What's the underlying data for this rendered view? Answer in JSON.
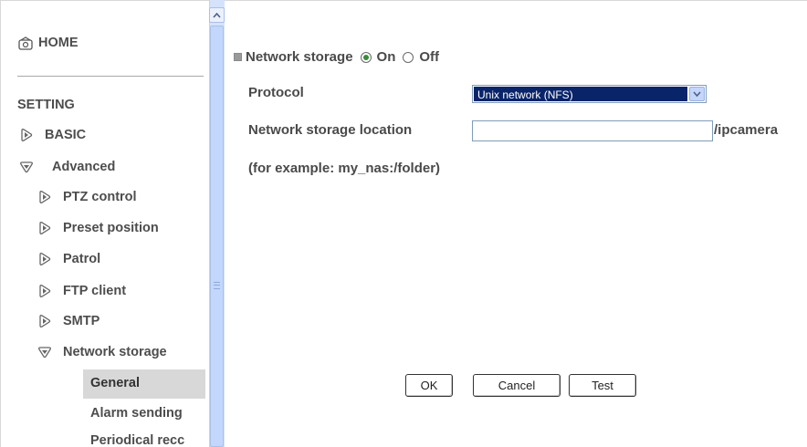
{
  "sidebar": {
    "home_label": "HOME",
    "setting_label": "SETTING",
    "items": [
      {
        "label": "BASIC",
        "state": "collapsed"
      },
      {
        "label": "Advanced",
        "state": "expanded"
      },
      {
        "label": "PTZ control",
        "state": "collapsed"
      },
      {
        "label": "Preset position",
        "state": "collapsed"
      },
      {
        "label": "Patrol",
        "state": "collapsed"
      },
      {
        "label": "FTP client",
        "state": "collapsed"
      },
      {
        "label": "SMTP",
        "state": "collapsed"
      },
      {
        "label": "Network storage",
        "state": "expanded"
      }
    ],
    "subitems": [
      {
        "label": "General",
        "selected": true
      },
      {
        "label": "Alarm sending",
        "selected": false
      },
      {
        "label": "Periodical recc",
        "selected": false
      }
    ]
  },
  "main": {
    "section_title": "Network storage",
    "radio_on_label": "On",
    "radio_off_label": "Off",
    "radio_selected": "On",
    "protocol_label": "Protocol",
    "protocol_value": "Unix network (NFS)",
    "location_label": "Network storage location",
    "location_value": "",
    "location_suffix": "/ipcamera",
    "example_text": "(for example: my_nas:/folder)",
    "buttons": {
      "ok": "OK",
      "cancel": "Cancel",
      "test": "Test"
    }
  },
  "colors": {
    "selection_bg": "#0a246a",
    "scrollbar_track": "#d4e3fb",
    "radio_checked": "#3a8a3a",
    "selected_item_bg": "#d8d8d8"
  }
}
